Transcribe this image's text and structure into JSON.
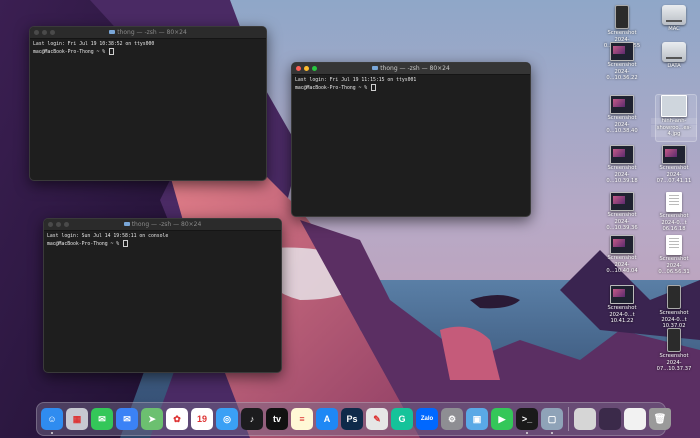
{
  "terminals": [
    {
      "title": "thong — -zsh — 80×24",
      "lines": [
        "Last login: Fri Jul 19 10:38:52 on ttys000",
        "mac@MacBook-Pro-Thong ~ % "
      ],
      "active": false
    },
    {
      "title": "thong — -zsh — 80×24",
      "lines": [
        "Last login: Fri Jul 19 11:15:15 on ttys001",
        "mac@MacBook-Pro-Thong ~ % "
      ],
      "active": true
    },
    {
      "title": "thong — -zsh — 80×24",
      "lines": [
        "Last login: Sun Jul 14 19:58:11 on console",
        "mac@MacBook-Pro-Thong ~ % "
      ],
      "active": false
    }
  ],
  "desktop_icons": [
    {
      "label1": "Screenshot",
      "label2": "2024-0...9.10.37.55",
      "kind": "phone"
    },
    {
      "label1": "MAC",
      "label2": "",
      "kind": "drive"
    },
    {
      "label1": "Screenshot",
      "label2": "2024-0...10.36.22",
      "kind": "shot"
    },
    {
      "label1": "DATA",
      "label2": "",
      "kind": "drive"
    },
    {
      "label1": "Screenshot",
      "label2": "2024-0...10.38.40",
      "kind": "shot"
    },
    {
      "label1": "hinh-anh-",
      "label2": "showroo...es-4.jpg",
      "kind": "jpg"
    },
    {
      "label1": "Screenshot",
      "label2": "2024-0...10.39.18",
      "kind": "shot"
    },
    {
      "label1": "Screenshot",
      "label2": "2024-07...07.41.11",
      "kind": "shot"
    },
    {
      "label1": "Screenshot",
      "label2": "2024-0...10.39.36",
      "kind": "shot"
    },
    {
      "label1": "Screenshot",
      "label2": "2024-0...t 06.16.18",
      "kind": "doc"
    },
    {
      "label1": "Screenshot",
      "label2": "2024-0...10.40.04",
      "kind": "shot"
    },
    {
      "label1": "Screenshot",
      "label2": "2024-0...06.56.31",
      "kind": "doc"
    },
    {
      "label1": "Screenshot",
      "label2": "2024-0...t 10.41.22",
      "kind": "shot"
    },
    {
      "label1": "Screenshot",
      "label2": "2024-0...t 10.37.02",
      "kind": "phone"
    },
    {
      "label1": "Screenshot",
      "label2": "2024-07...10.37.37",
      "kind": "phone"
    }
  ],
  "dock": [
    {
      "name": "Finder",
      "color": "#2f8cf0",
      "glyph": "☺"
    },
    {
      "name": "Launchpad",
      "color": "#c7c9d1",
      "glyph": "▦"
    },
    {
      "name": "Messages",
      "color": "#34c759",
      "glyph": "✉"
    },
    {
      "name": "Mail",
      "color": "#3b82f6",
      "glyph": "✉"
    },
    {
      "name": "Maps",
      "color": "#6cc070",
      "glyph": "➤"
    },
    {
      "name": "Photos",
      "color": "#ffffff",
      "glyph": "✿"
    },
    {
      "name": "Calendar",
      "color": "#ffffff",
      "glyph": "19"
    },
    {
      "name": "Safari",
      "color": "#3aa0f5",
      "glyph": "◎"
    },
    {
      "name": "Notes",
      "color": "#1c1c1e",
      "glyph": "♪"
    },
    {
      "name": "Apple TV",
      "color": "#111111",
      "glyph": "tv"
    },
    {
      "name": "Notes App",
      "color": "#fff8d6",
      "glyph": "≡"
    },
    {
      "name": "App Store",
      "color": "#1e88f5",
      "glyph": "A"
    },
    {
      "name": "Photoshop",
      "color": "#0f2a4a",
      "glyph": "Ps"
    },
    {
      "name": "Script Editor",
      "color": "#e6e6e6",
      "glyph": "✎"
    },
    {
      "name": "Grammarly",
      "color": "#15c39a",
      "glyph": "G"
    },
    {
      "name": "Zalo",
      "color": "#0068ff",
      "glyph": "Zalo"
    },
    {
      "name": "System Settings",
      "color": "#8e8e93",
      "glyph": "⚙"
    },
    {
      "name": "Preview",
      "color": "#5aa9e6",
      "glyph": "▣"
    },
    {
      "name": "FaceTime",
      "color": "#34c759",
      "glyph": "▶"
    },
    {
      "name": "Terminal",
      "color": "#1a1a1a",
      "glyph": ">_"
    },
    {
      "name": "Screenshot",
      "color": "#8fa3b8",
      "glyph": "▢"
    }
  ],
  "dock_recent": [
    {
      "name": "Recent 1",
      "color": "#d6d6d6"
    },
    {
      "name": "Recent 2",
      "color": "#3b2a4a"
    },
    {
      "name": "Recent 3",
      "color": "#f2f2f2"
    },
    {
      "name": "Trash",
      "color": "#9a9a9a"
    }
  ],
  "colors": {
    "traffic_red": "#fe5f57",
    "traffic_yellow": "#febc2e",
    "traffic_green": "#28c840",
    "terminal_bg": "#1e1e1e"
  }
}
